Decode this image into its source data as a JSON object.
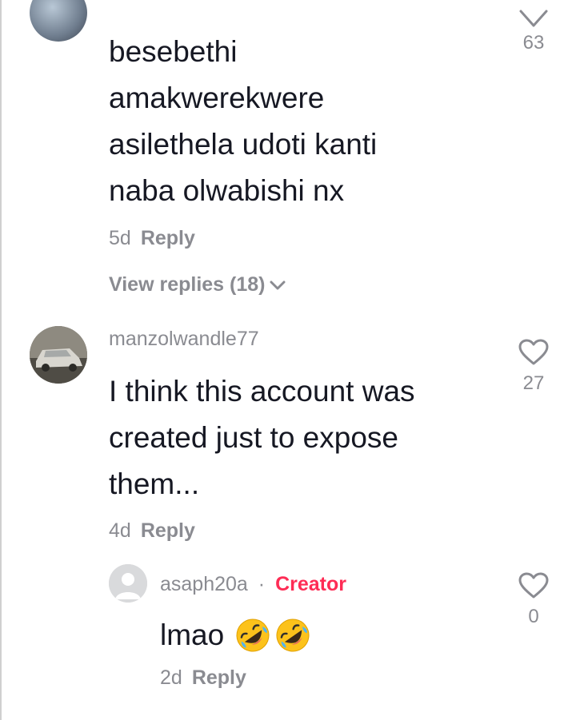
{
  "comments": [
    {
      "text_lines": [
        "besebethi",
        "amakwerekwere",
        "asilethela udoti kanti",
        "naba olwabishi nx"
      ],
      "age": "5d",
      "reply_label": "Reply",
      "likes": "63",
      "view_replies": "View replies (18)"
    },
    {
      "username": "manzolwandle77",
      "text_lines": [
        "I think this account was",
        "created just to expose",
        "them..."
      ],
      "age": "4d",
      "reply_label": "Reply",
      "likes": "27"
    }
  ],
  "reply": {
    "username": "asaph20a",
    "separator": "·",
    "badge": "Creator",
    "text": "lmao",
    "age": "2d",
    "reply_label": "Reply",
    "likes": "0"
  },
  "icons": {
    "collapse": "chevron-down-icon",
    "like": "heart-outline-icon",
    "emoji": "rolling-on-floor-laughing-emoji"
  },
  "colors": {
    "text": "#161823",
    "secondary": "#8a8b91",
    "creator": "#fe2c55"
  }
}
